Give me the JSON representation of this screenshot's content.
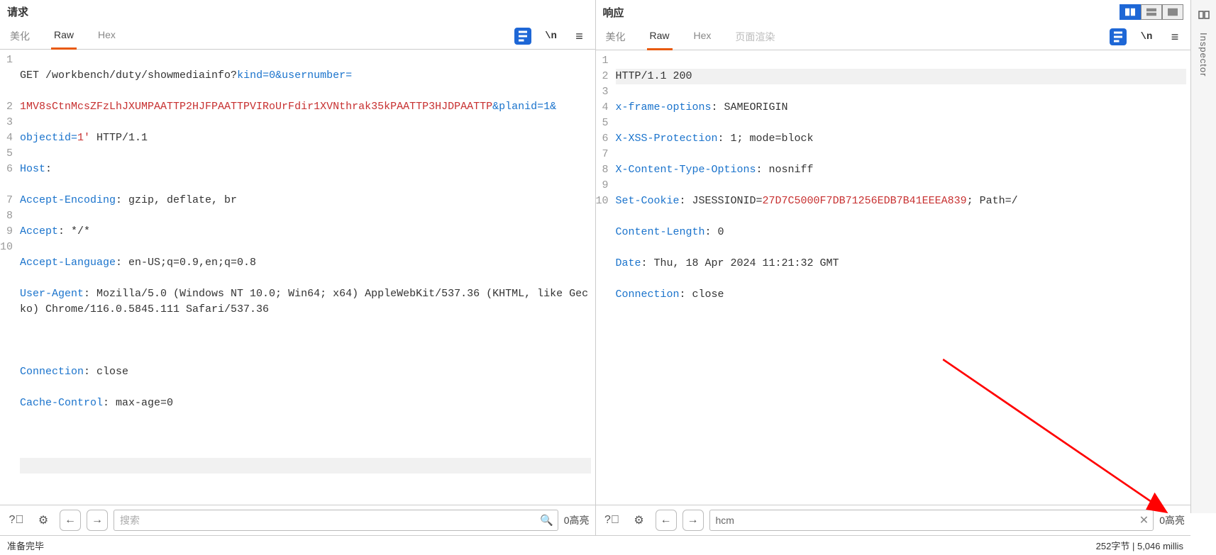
{
  "request": {
    "title": "请求",
    "tabs": {
      "beautify": "美化",
      "raw": "Raw",
      "hex": "Hex"
    },
    "tools": {
      "wrap": "\\n",
      "menu": "≡"
    },
    "code": {
      "line1_method": "GET ",
      "line1_path": "/workbench/duty/showmediainfo?",
      "line1_k1": "kind",
      "line1_eq": "=",
      "line1_v1": "0",
      "line1_amp1": "&",
      "line1_k2": "usernumber",
      "line1b_val": "1MV8sCtnMcsZFzLhJXUMPAATTP2HJFPAATTPVIRoUrFdir1XVNthrak35kPAATTP3HJDPAATTP",
      "line1b_amp2": "&",
      "line1b_k3": "planid",
      "line1b_v3": "1",
      "line1b_amp3": "&",
      "line1c_k4": "objectid",
      "line1c_v4": "1'",
      "line1c_proto": " HTTP/1.1",
      "line2_h": "Host",
      "line2_v": ":",
      "line3_h": "Accept-Encoding",
      "line3_v": ": gzip, deflate, br",
      "line4_h": "Accept",
      "line4_v": ": */*",
      "line5_h": "Accept-Language",
      "line5_v": ": en-US;q=0.9,en;q=0.8",
      "line6_h": "User-Agent",
      "line6_v": ": Mozilla/5.0 (Windows NT 10.0; Win64; x64) AppleWebKit/537.36 (KHTML, like Gecko) Chrome/116.0.5845.111 Safari/537.36",
      "line7_h": "Connection",
      "line7_v": ": close",
      "line8_h": "Cache-Control",
      "line8_v": ": max-age=0"
    },
    "search_placeholder": "搜索",
    "highlight_count": "0高亮"
  },
  "response": {
    "title": "响应",
    "tabs": {
      "beautify": "美化",
      "raw": "Raw",
      "hex": "Hex",
      "render": "页面渲染"
    },
    "tools": {
      "wrap": "\\n",
      "menu": "≡"
    },
    "code": {
      "line1": "HTTP/1.1 200",
      "line2_h": "x-frame-options",
      "line2_v": ": SAMEORIGIN",
      "line3_h": "X-XSS-Protection",
      "line3_v": ": 1; mode=block",
      "line4_h": "X-Content-Type-Options",
      "line4_v": ": nosniff",
      "line5_h": "Set-Cookie",
      "line5_k": ": JSESSIONID=",
      "line5_val": "27D7C5000F7DB71256EDB7B41EEEA839",
      "line5_rest": "; Path=/",
      "line6_h": "Content-Length",
      "line6_v": ": 0",
      "line7_h": "Date",
      "line7_v": ": Thu, 18 Apr 2024 11:21:32 GMT",
      "line8_h": "Connection",
      "line8_v": ": close"
    },
    "search_value": "hcm",
    "highlight_count": "0高亮"
  },
  "status": {
    "left": "准备完毕",
    "right": "252字节 | 5,046 millis"
  },
  "inspector": {
    "label": "Inspector"
  }
}
